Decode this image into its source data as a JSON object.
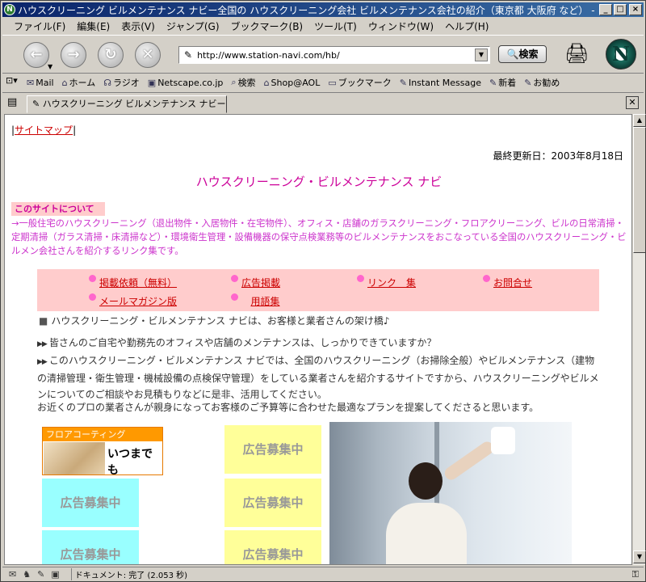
{
  "window": {
    "title": "ハウスクリーニング ビルメンテナンス ナビー全国の ハウスクリーニング会社 ビルメンテナンス会社の紹介（東京都 大阪府 など） - Netscape",
    "min": "_",
    "max": "□",
    "close": "×"
  },
  "menu": [
    "ファイル(F)",
    "編集(E)",
    "表示(V)",
    "ジャンプ(G)",
    "ブックマーク(B)",
    "ツール(T)",
    "ウィンドウ(W)",
    "ヘルプ(H)"
  ],
  "nav": {
    "url": "http://www.station-navi.com/hb/",
    "search_label": "検索"
  },
  "personal_toolbar": [
    {
      "icon": "mail-icon",
      "label": "Mail"
    },
    {
      "icon": "home-icon",
      "label": "ホーム"
    },
    {
      "icon": "radio-icon",
      "label": "ラジオ"
    },
    {
      "icon": "my-icon",
      "label": "Netscape.co.jp"
    },
    {
      "icon": "search-icon",
      "label": "検索"
    },
    {
      "icon": "shop-icon",
      "label": "Shop@AOL"
    },
    {
      "icon": "folder-icon",
      "label": "ブックマーク"
    },
    {
      "icon": "bookmark-icon",
      "label": "Instant Message"
    },
    {
      "icon": "bookmark-icon",
      "label": "新着"
    },
    {
      "icon": "bookmark-icon",
      "label": "お勧め"
    }
  ],
  "tab": {
    "label": "ハウスクリーニング ビルメンテナンス ナビー全..."
  },
  "page": {
    "sitemap": "サイトマップ",
    "updated": "最終更新日：2003年8月18日",
    "title": "ハウスクリーニング・ビルメンテナンス ナビ",
    "about_label": "このサイトについて",
    "about_text": "→一般住宅のハウスクリーニング（退出物件・入居物件・在宅物件）、オフィス・店舗のガラスクリーニング・フロアクリーニング、ビルの日常清掃・定期清掃（ガラス清掃・床清掃など）・環境衛生管理・設備機器の保守点検業務等のビルメンテナンスをおこなっている全国のハウスクリーニング・ビルメン会社さんを紹介するリンク集です。",
    "links": [
      "掲載依頼（無料）",
      "広告掲載",
      "リンク　集",
      "お問合せ",
      "メールマガジン版",
      "用語集"
    ],
    "intro": "ハウスクリーニング・ビルメンテナンス ナビは、お客様と業者さんの架け橋♪",
    "para1": "皆さんのご自宅や勤務先のオフィスや店舗のメンテナンスは、しっかりできていますか？",
    "para2": "このハウスクリーニング・ビルメンテナンス ナビでは、全国のハウスクリーニング（お掃除全般）やビルメンテナンス（建物の清掃管理・衛生管理・機械設備の点検保守管理）をしている業者さんを紹介するサイトですから、ハウスクリーニングやビルメンについてのご相談やお見積もりなどに是非、活用してください。",
    "para3": "お近くのプロの業者さんが親身になってお客様のご予算等に合わせた最適なプランを提案してくださると思います。",
    "ad_flooring_header": "フロアコーティング",
    "ad_flooring_text": "いつまでも",
    "ad_label": "広告募集中"
  },
  "status": {
    "text": "ドキュメント: 完了 (2.053 秒)"
  }
}
